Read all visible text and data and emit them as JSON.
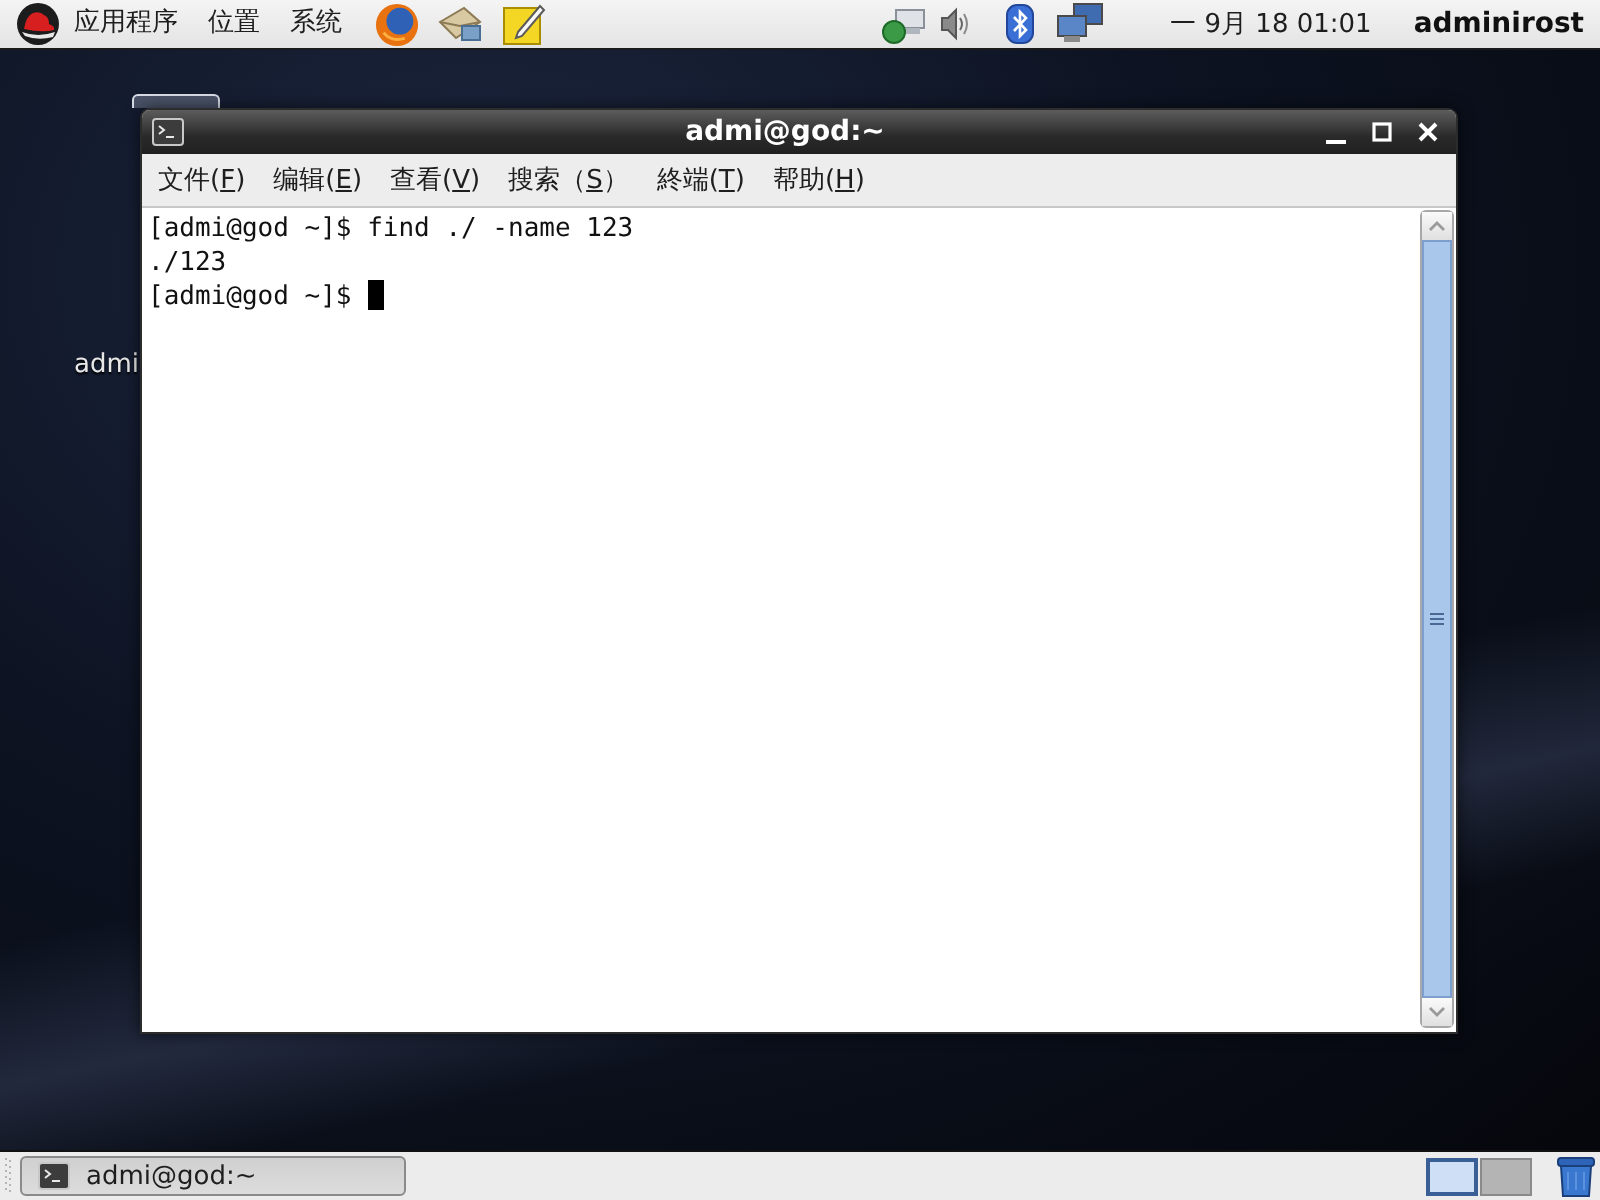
{
  "top_panel": {
    "menus": [
      {
        "label": "应用程序"
      },
      {
        "label": "位置"
      },
      {
        "label": "系统"
      }
    ],
    "clock": "一 9月 18 01:01",
    "user": "adminirost"
  },
  "desktop": {
    "icon_labels": [
      "admi"
    ]
  },
  "terminal_window": {
    "title": "admi@god:~",
    "menu": [
      {
        "before": "文件(",
        "key": "F",
        "after": ")"
      },
      {
        "before": "编辑(",
        "key": "E",
        "after": ")"
      },
      {
        "before": "查看(",
        "key": "V",
        "after": ")"
      },
      {
        "before": "搜索（",
        "key": "S",
        "after": "）"
      },
      {
        "before": "終端(",
        "key": "T",
        "after": ")"
      },
      {
        "before": "帮助(",
        "key": "H",
        "after": ")"
      }
    ],
    "lines": [
      {
        "text": "[admi@god ~]$ find ./ -name 123",
        "cursor": false
      },
      {
        "text": "./123",
        "cursor": false
      },
      {
        "text": "[admi@god ~]$ ",
        "cursor": true
      }
    ]
  },
  "bottom_panel": {
    "tasks": [
      {
        "label": "admi@god:~",
        "selected": true
      }
    ],
    "workspaces": [
      {
        "selected": true
      },
      {
        "selected": false
      }
    ]
  }
}
